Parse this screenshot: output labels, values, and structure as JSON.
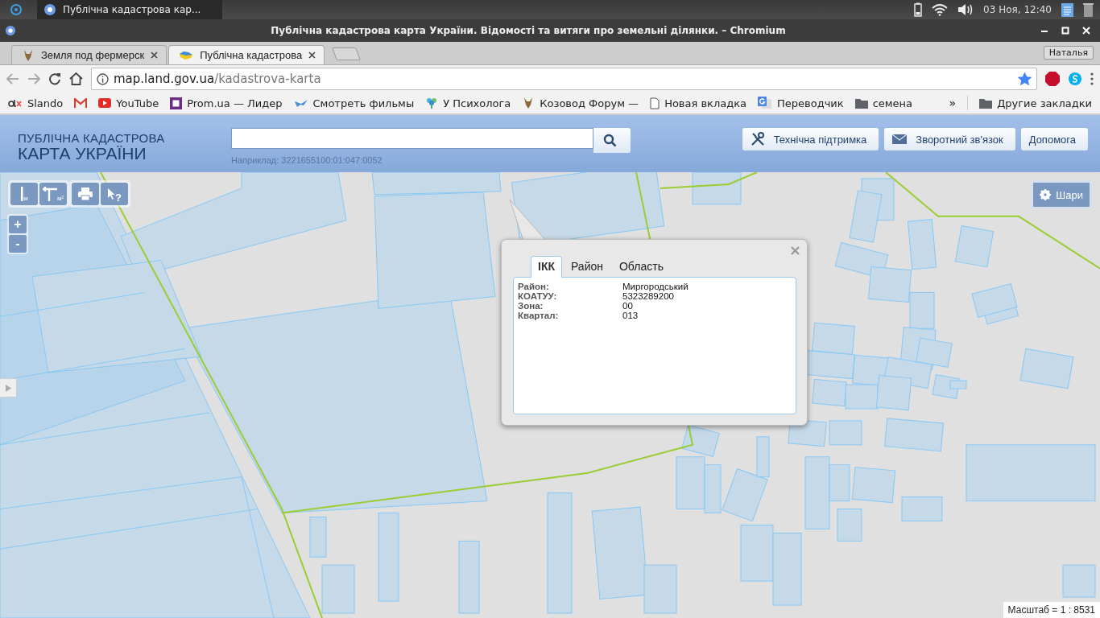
{
  "desktop_bar": {
    "taskbar_item": "Публічна кадастрова кар...",
    "clock": "03 Ноя, 12:40"
  },
  "window": {
    "title": "Публічна кадастрова карта України. Відомості та витяги про земельні ділянки. – Chromium",
    "profile": "Наталья"
  },
  "tabs": [
    {
      "label": "Земля под фермерск",
      "kind": "goat",
      "selected": false
    },
    {
      "label": "Публічна кадастрова",
      "kind": "map",
      "selected": true
    }
  ],
  "address_bar": {
    "host": "map.land.gov.ua",
    "path": "/kadastrova-karta",
    "bookmarked": true
  },
  "bookmarks": [
    {
      "kind": "olx",
      "label": "Slando"
    },
    {
      "kind": "gmail"
    },
    {
      "kind": "youtube",
      "label": "YouTube"
    },
    {
      "kind": "prom",
      "label": "Prom.ua — Лидер"
    },
    {
      "kind": "film",
      "label": "Смотреть фильмы"
    },
    {
      "kind": "tree",
      "label": "У Психолога"
    },
    {
      "kind": "goat",
      "label": "Козовод Форум —"
    },
    {
      "kind": "page",
      "label": "Новая вкладка"
    },
    {
      "kind": "translate",
      "label": "Переводчик"
    },
    {
      "kind": "folder",
      "label": "семена"
    }
  ],
  "bookmarks_overflow": "»",
  "other_bookmarks": "Другие закладки",
  "site_header": {
    "logo_line1": "ПУБЛІЧНА КАДАСТРОВА",
    "logo_line2": "КАРТА УКРАЇНИ",
    "search_hint": "Наприклад: 3221655100:01:047:0052",
    "buttons": [
      {
        "kind": "tools",
        "label": "Технічна підтримка"
      },
      {
        "kind": "mail",
        "label": "Зворотний зв'язок"
      },
      {
        "kind": "plain",
        "label": "Допомога"
      }
    ]
  },
  "map_tools": {
    "length_unit": "м",
    "area_unit": "м²",
    "identify_mark": "?",
    "zoom_in": "+",
    "zoom_out": "-",
    "layers": "Шари"
  },
  "popup": {
    "tabs": [
      {
        "label": "ІКК",
        "selected": true
      },
      {
        "label": "Район",
        "selected": false
      },
      {
        "label": "Область",
        "selected": false
      }
    ],
    "fields": [
      {
        "label": "Район:",
        "value": "Миргородський"
      },
      {
        "label": "КОАТУУ:",
        "value": "5323289200"
      },
      {
        "label": "Зона:",
        "value": "00"
      },
      {
        "label": "Квартал:",
        "value": "013"
      }
    ]
  },
  "scale": "Масштаб = 1 : 8531"
}
